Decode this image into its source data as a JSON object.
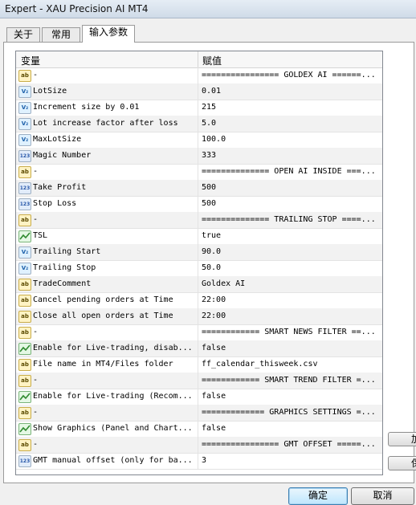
{
  "window": {
    "title": "Expert - XAU Precision AI MT4"
  },
  "tabs": [
    {
      "label": "关于"
    },
    {
      "label": "常用"
    },
    {
      "label": "输入参数",
      "active": true
    }
  ],
  "grid": {
    "headers": {
      "variable": "变量",
      "value": "赋值"
    },
    "rows": [
      {
        "icon": "ab",
        "name": "-",
        "value": "================ GOLDEX AI ======..."
      },
      {
        "icon": "v2",
        "name": "LotSize",
        "value": "0.01"
      },
      {
        "icon": "v2",
        "name": "Increment size by 0.01",
        "value": "215"
      },
      {
        "icon": "v2",
        "name": "Lot increase factor after loss",
        "value": "5.0"
      },
      {
        "icon": "v2",
        "name": "MaxLotSize",
        "value": "100.0"
      },
      {
        "icon": "123",
        "name": "Magic Number",
        "value": "333"
      },
      {
        "icon": "ab",
        "name": "-",
        "value": "============== OPEN AI INSIDE ===..."
      },
      {
        "icon": "123",
        "name": "Take Profit",
        "value": "500"
      },
      {
        "icon": "123",
        "name": "Stop Loss",
        "value": "500"
      },
      {
        "icon": "ab",
        "name": "-",
        "value": "============== TRAILING STOP ====..."
      },
      {
        "icon": "tsl",
        "name": "TSL",
        "value": "true"
      },
      {
        "icon": "v2",
        "name": "Trailing Start",
        "value": "90.0"
      },
      {
        "icon": "v2",
        "name": "Trailing Stop",
        "value": "50.0"
      },
      {
        "icon": "ab",
        "name": "TradeComment",
        "value": "Goldex AI"
      },
      {
        "icon": "ab",
        "name": "Cancel pending orders at Time",
        "value": "22:00"
      },
      {
        "icon": "ab",
        "name": "Close all open orders at Time",
        "value": "22:00"
      },
      {
        "icon": "ab",
        "name": "-",
        "value": "============ SMART NEWS FILTER ==..."
      },
      {
        "icon": "tsl",
        "name": "Enable for Live-trading, disab...",
        "value": "false"
      },
      {
        "icon": "ab",
        "name": "File name in MT4/Files folder",
        "value": "ff_calendar_thisweek.csv"
      },
      {
        "icon": "ab",
        "name": "-",
        "value": "============ SMART TREND FILTER =..."
      },
      {
        "icon": "tsl",
        "name": "Enable for Live-trading (Recom...",
        "value": "false"
      },
      {
        "icon": "ab",
        "name": "-",
        "value": "============= GRAPHICS SETTINGS =..."
      },
      {
        "icon": "tsl",
        "name": "Show Graphics (Panel and Chart...",
        "value": "false"
      },
      {
        "icon": "ab",
        "name": "-",
        "value": "================ GMT OFFSET =====..."
      },
      {
        "icon": "123",
        "name": "GMT manual offset (only for ba...",
        "value": "3"
      }
    ]
  },
  "side_buttons": [
    {
      "label": "加"
    },
    {
      "label": "保"
    }
  ],
  "buttons": {
    "ok": "确定",
    "cancel": "取消"
  }
}
